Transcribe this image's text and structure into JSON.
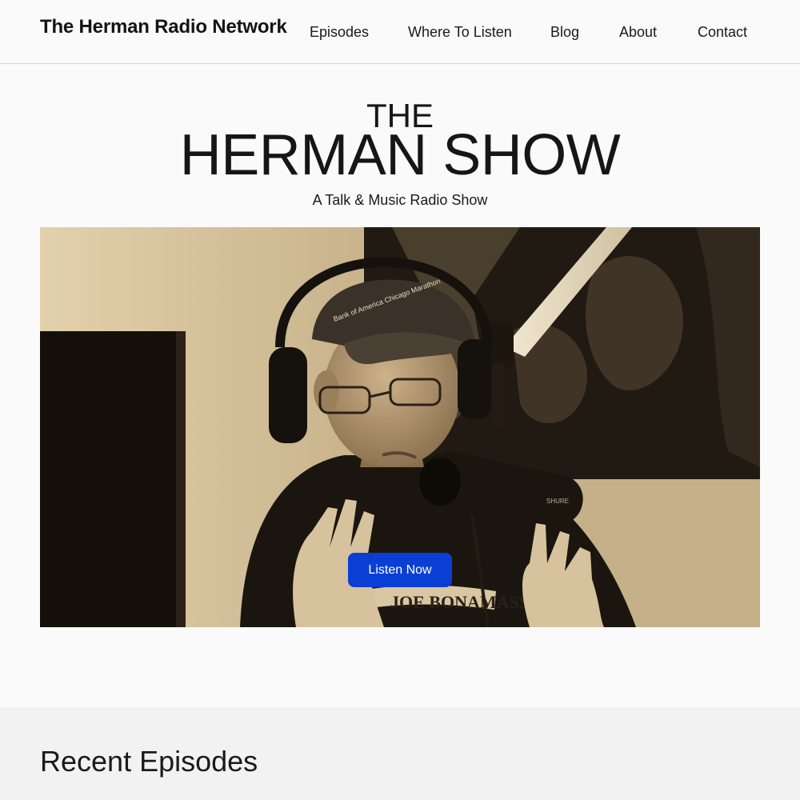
{
  "header": {
    "site_title": "The Herman Radio Network",
    "nav": [
      {
        "label": "Episodes"
      },
      {
        "label": "Where To Listen"
      },
      {
        "label": "Blog"
      },
      {
        "label": "About"
      },
      {
        "label": "Contact"
      }
    ]
  },
  "hero": {
    "title_small": "THE",
    "title_large": "HERMAN SHOW",
    "subtitle": "A Talk & Music Radio Show",
    "cta_label": "Listen Now",
    "photo": {
      "description": "sepia photo of a radio host in headphones and a cap speaking into a microphone",
      "cap_text": "Bank of America Chicago Marathon",
      "shirt_text": "JOE BONAMASSA",
      "mic_brand": "SHURE"
    }
  },
  "recent_episodes": {
    "heading": "Recent Episodes"
  },
  "colors": {
    "accent": "#0a3fd6",
    "background": "#fafafa",
    "section_background": "#f2f2f2",
    "sepia_light": "#d8c49e",
    "sepia_dark": "#1e1710"
  }
}
